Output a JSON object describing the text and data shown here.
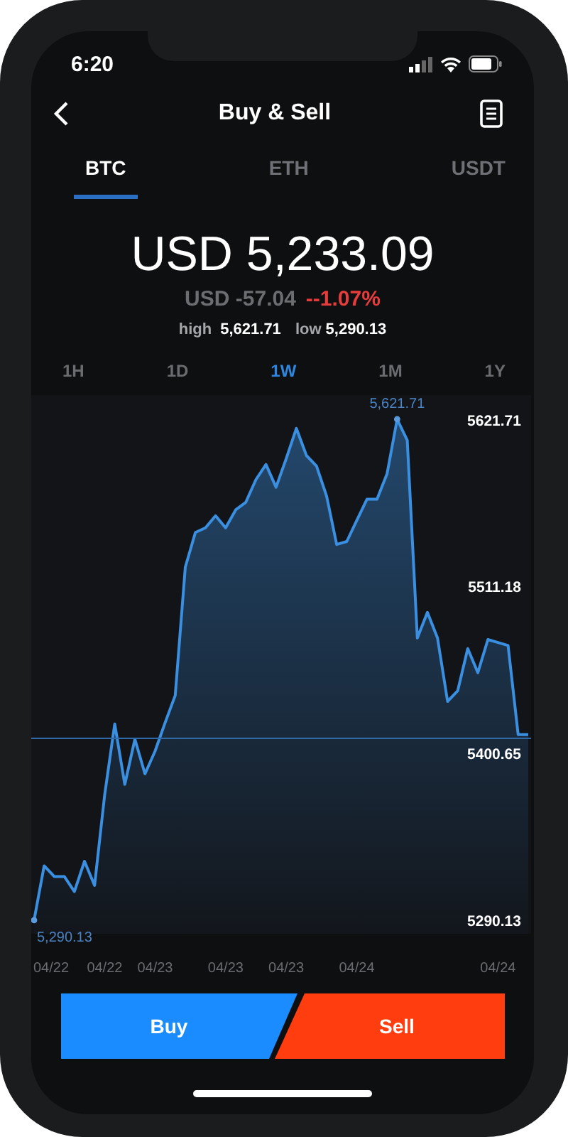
{
  "status_bar": {
    "time": "6:20"
  },
  "header": {
    "title": "Buy & Sell"
  },
  "tabs": [
    {
      "label": "BTC",
      "selected": true
    },
    {
      "label": "ETH",
      "selected": false
    },
    {
      "label": "USDT",
      "selected": false
    }
  ],
  "quote": {
    "price": "USD 5,233.09",
    "change": "USD -57.04",
    "change_percent": "--1.07%",
    "high_label": "high",
    "high": "5,621.71",
    "low_label": "low",
    "low": "5,290.13"
  },
  "periods": [
    {
      "label": "1H",
      "selected": false
    },
    {
      "label": "1D",
      "selected": false
    },
    {
      "label": "1W",
      "selected": true
    },
    {
      "label": "1M",
      "selected": false
    },
    {
      "label": "1Y",
      "selected": false
    }
  ],
  "chart": {
    "chart_data": {
      "type": "area",
      "ylim": [
        5281,
        5638
      ],
      "yticks": [
        5290.13,
        5400.65,
        5511.18,
        5621.71
      ],
      "categories": [
        null,
        "04/22",
        null,
        null,
        null,
        null,
        null,
        "04/22",
        null,
        null,
        null,
        null,
        "04/23",
        null,
        null,
        null,
        null,
        null,
        null,
        "04/23",
        null,
        null,
        null,
        null,
        null,
        "04/23",
        null,
        null,
        null,
        null,
        null,
        null,
        "04/24",
        null,
        null,
        null,
        null,
        null,
        null,
        null,
        null,
        null,
        null,
        null,
        null,
        null,
        "04/24",
        null,
        null,
        null
      ],
      "series": [
        {
          "color": "#3b8fe0",
          "values": [
            5290,
            5326,
            5319,
            5319,
            5309,
            5329,
            5313,
            5373,
            5420,
            5380,
            5410,
            5387,
            5402,
            5421,
            5439,
            5524,
            5547,
            5550,
            5558,
            5550,
            5562,
            5567,
            5582,
            5592,
            5577,
            5596,
            5616,
            5598,
            5591,
            5571,
            5539,
            5541,
            5555,
            5569,
            5569,
            5586,
            5622,
            5608,
            5477,
            5494,
            5477,
            5435,
            5442,
            5470,
            5454,
            5476,
            5474,
            5472,
            5413,
            5413
          ]
        }
      ],
      "annotations": [
        "5,621.71",
        "5,290.13"
      ]
    }
  },
  "actions": [
    {
      "label": "Buy",
      "kind": "buy"
    },
    {
      "label": "Sell",
      "kind": "sell"
    }
  ]
}
